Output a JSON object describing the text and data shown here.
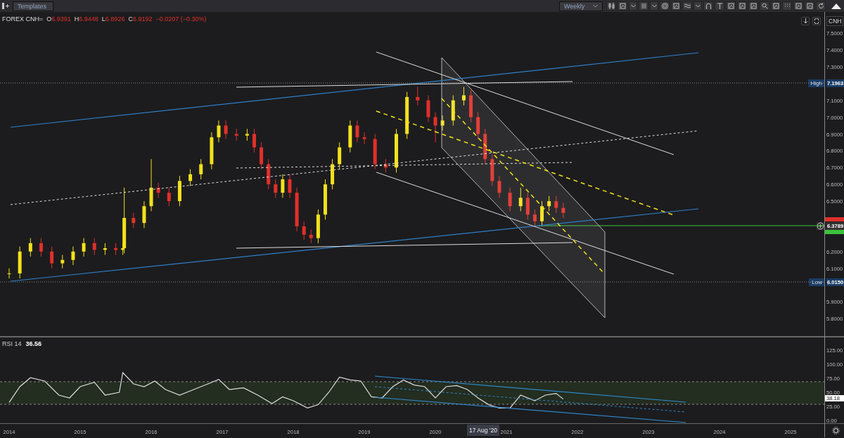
{
  "toolbar": {
    "templates": "Templates",
    "interval": "Weekly"
  },
  "legend": {
    "symbol": "FOREX CNH=",
    "fields": [
      {
        "label": "O",
        "value": "6.9391"
      },
      {
        "label": "H",
        "value": "6.9448"
      },
      {
        "label": "L",
        "value": "6.8926"
      },
      {
        "label": "C",
        "value": "6.9192"
      }
    ],
    "change": "−0.0207 (−0.30%)"
  },
  "currency": "CNH",
  "price_markers": [
    {
      "kind": "high",
      "label": "High",
      "value": "7.1963"
    },
    {
      "kind": "current",
      "value": "6.3789"
    },
    {
      "kind": "low",
      "label": "Low",
      "value": "6.0150"
    }
  ],
  "price_chart": {
    "chart_data": {
      "type": "candlestick",
      "x": [
        2014.0,
        2014.15,
        2014.3,
        2014.45,
        2014.6,
        2014.75,
        2014.9,
        2015.05,
        2015.2,
        2015.35,
        2015.5,
        2015.6,
        2015.62,
        2015.75,
        2015.9,
        2016.0,
        2016.1,
        2016.25,
        2016.4,
        2016.55,
        2016.7,
        2016.85,
        2016.95,
        2017.05,
        2017.2,
        2017.35,
        2017.45,
        2017.55,
        2017.65,
        2017.75,
        2017.85,
        2017.95,
        2018.05,
        2018.15,
        2018.25,
        2018.35,
        2018.45,
        2018.55,
        2018.65,
        2018.8,
        2018.9,
        2019.0,
        2019.15,
        2019.3,
        2019.45,
        2019.6,
        2019.75,
        2019.9,
        2020.0,
        2020.1,
        2020.25,
        2020.4,
        2020.5,
        2020.6,
        2020.7,
        2020.8,
        2020.9,
        2021.05,
        2021.2,
        2021.3,
        2021.4,
        2021.5,
        2021.6,
        2021.7,
        2021.8
      ],
      "ohlc": [
        [
          6.07,
          6.1,
          6.04,
          6.07
        ],
        [
          6.07,
          6.23,
          6.04,
          6.2
        ],
        [
          6.2,
          6.28,
          6.17,
          6.25
        ],
        [
          6.25,
          6.28,
          6.17,
          6.2
        ],
        [
          6.2,
          6.23,
          6.1,
          6.13
        ],
        [
          6.13,
          6.18,
          6.1,
          6.15
        ],
        [
          6.15,
          6.23,
          6.12,
          6.2
        ],
        [
          6.2,
          6.28,
          6.17,
          6.25
        ],
        [
          6.25,
          6.28,
          6.18,
          6.21
        ],
        [
          6.21,
          6.25,
          6.18,
          6.22
        ],
        [
          6.22,
          6.25,
          6.18,
          6.21
        ],
        [
          6.21,
          6.25,
          6.18,
          6.22
        ],
        [
          6.22,
          6.58,
          6.19,
          6.4
        ],
        [
          6.4,
          6.43,
          6.34,
          6.37
        ],
        [
          6.37,
          6.5,
          6.34,
          6.47
        ],
        [
          6.47,
          6.75,
          6.44,
          6.58
        ],
        [
          6.58,
          6.61,
          6.52,
          6.55
        ],
        [
          6.55,
          6.58,
          6.47,
          6.5
        ],
        [
          6.5,
          6.65,
          6.47,
          6.62
        ],
        [
          6.62,
          6.69,
          6.59,
          6.66
        ],
        [
          6.66,
          6.75,
          6.63,
          6.72
        ],
        [
          6.72,
          6.91,
          6.69,
          6.88
        ],
        [
          6.88,
          6.98,
          6.85,
          6.95
        ],
        [
          6.95,
          6.98,
          6.87,
          6.9
        ],
        [
          6.9,
          6.93,
          6.86,
          6.89
        ],
        [
          6.89,
          6.93,
          6.86,
          6.9
        ],
        [
          6.9,
          6.93,
          6.79,
          6.82
        ],
        [
          6.82,
          6.85,
          6.69,
          6.72
        ],
        [
          6.72,
          6.75,
          6.57,
          6.6
        ],
        [
          6.6,
          6.63,
          6.52,
          6.55
        ],
        [
          6.55,
          6.66,
          6.52,
          6.63
        ],
        [
          6.63,
          6.66,
          6.52,
          6.55
        ],
        [
          6.55,
          6.58,
          6.32,
          6.35
        ],
        [
          6.35,
          6.38,
          6.27,
          6.3
        ],
        [
          6.3,
          6.33,
          6.25,
          6.28
        ],
        [
          6.28,
          6.45,
          6.25,
          6.42
        ],
        [
          6.42,
          6.63,
          6.39,
          6.6
        ],
        [
          6.6,
          6.75,
          6.57,
          6.72
        ],
        [
          6.72,
          6.85,
          6.69,
          6.82
        ],
        [
          6.82,
          6.98,
          6.79,
          6.95
        ],
        [
          6.95,
          6.98,
          6.85,
          6.88
        ],
        [
          6.88,
          6.91,
          6.84,
          6.87
        ],
        [
          6.87,
          6.9,
          6.69,
          6.72
        ],
        [
          6.72,
          6.75,
          6.67,
          6.7
        ],
        [
          6.7,
          6.93,
          6.67,
          6.9
        ],
        [
          6.9,
          7.15,
          6.87,
          7.12
        ],
        [
          7.12,
          7.18,
          7.07,
          7.1
        ],
        [
          7.1,
          7.13,
          6.97,
          7.0
        ],
        [
          7.0,
          7.03,
          6.85,
          6.95
        ],
        [
          6.95,
          7.01,
          6.92,
          6.98
        ],
        [
          6.98,
          7.13,
          6.95,
          7.1
        ],
        [
          7.1,
          7.18,
          7.07,
          7.13
        ],
        [
          7.13,
          7.16,
          6.97,
          7.0
        ],
        [
          7.0,
          7.03,
          6.87,
          6.9
        ],
        [
          6.9,
          6.93,
          6.72,
          6.75
        ],
        [
          6.75,
          6.78,
          6.59,
          6.62
        ],
        [
          6.62,
          6.65,
          6.52,
          6.55
        ],
        [
          6.55,
          6.58,
          6.44,
          6.47
        ],
        [
          6.47,
          6.58,
          6.44,
          6.52
        ],
        [
          6.52,
          6.55,
          6.39,
          6.42
        ],
        [
          6.42,
          6.45,
          6.35,
          6.38
        ],
        [
          6.38,
          6.5,
          6.35,
          6.47
        ],
        [
          6.47,
          6.53,
          6.44,
          6.5
        ],
        [
          6.5,
          6.53,
          6.43,
          6.46
        ],
        [
          6.46,
          6.49,
          6.4,
          6.43
        ]
      ],
      "xlim": [
        2013.871,
        2025.752
      ],
      "ylim": [
        5.697,
        7.626
      ],
      "yticks": [
        {
          "value": 5.8,
          "label": "5.8000"
        },
        {
          "value": 5.9,
          "label": "5.9000"
        },
        {
          "value": 6.1,
          "label": "6.1000"
        },
        {
          "value": 6.2,
          "label": "6.2000"
        },
        {
          "value": 6.5,
          "label": "6.5000"
        },
        {
          "value": 6.6,
          "label": "6.6000"
        },
        {
          "value": 6.7,
          "label": "6.7000"
        },
        {
          "value": 6.8,
          "label": "6.8000"
        },
        {
          "value": 6.9,
          "label": "6.9000"
        },
        {
          "value": 7.0,
          "label": "7.0000"
        },
        {
          "value": 7.1,
          "label": "7.1000"
        },
        {
          "value": 7.3,
          "label": "7.3000"
        },
        {
          "value": 7.4,
          "label": "7.4000"
        },
        {
          "value": 7.5,
          "label": "7.5000"
        }
      ]
    }
  },
  "rsi": {
    "label": "RSI 14",
    "value": "36.56",
    "current": "38.18",
    "chart_data": {
      "type": "line",
      "x": [
        2014.0,
        2014.15,
        2014.3,
        2014.5,
        2014.7,
        2014.85,
        2015.0,
        2015.2,
        2015.35,
        2015.55,
        2015.6,
        2015.75,
        2015.9,
        2016.05,
        2016.2,
        2016.4,
        2016.6,
        2016.8,
        2016.95,
        2017.1,
        2017.3,
        2017.5,
        2017.7,
        2017.85,
        2018.0,
        2018.2,
        2018.35,
        2018.5,
        2018.65,
        2018.8,
        2018.95,
        2019.1,
        2019.25,
        2019.4,
        2019.55,
        2019.7,
        2019.85,
        2020.0,
        2020.15,
        2020.3,
        2020.45,
        2020.6,
        2020.75,
        2020.9,
        2021.05,
        2021.2,
        2021.4,
        2021.55,
        2021.7,
        2021.8
      ],
      "values": [
        32,
        60,
        76,
        70,
        45,
        40,
        60,
        68,
        45,
        50,
        85,
        65,
        60,
        70,
        55,
        45,
        55,
        65,
        73,
        55,
        58,
        45,
        30,
        42,
        35,
        22,
        28,
        50,
        77,
        72,
        70,
        42,
        40,
        60,
        72,
        63,
        60,
        40,
        60,
        62,
        55,
        40,
        28,
        22,
        22,
        45,
        35,
        45,
        48,
        38
      ],
      "xlim": [
        2013.871,
        2025.752
      ],
      "ylim": [
        -5.6,
        150
      ],
      "yticks": [
        {
          "value": 0,
          "label": "0.00"
        },
        {
          "value": 25,
          "label": "25.00"
        },
        {
          "value": 50,
          "label": "50.00"
        },
        {
          "value": 75,
          "label": "75.00"
        },
        {
          "value": 100,
          "label": "100.00"
        },
        {
          "value": 125,
          "label": "125.00"
        }
      ],
      "xticks": [
        2014,
        2015,
        2016,
        2017,
        2018,
        2019,
        2020,
        2021,
        2022,
        2023,
        2024,
        2025
      ]
    }
  },
  "crosshair_date": "17 Aug '20"
}
